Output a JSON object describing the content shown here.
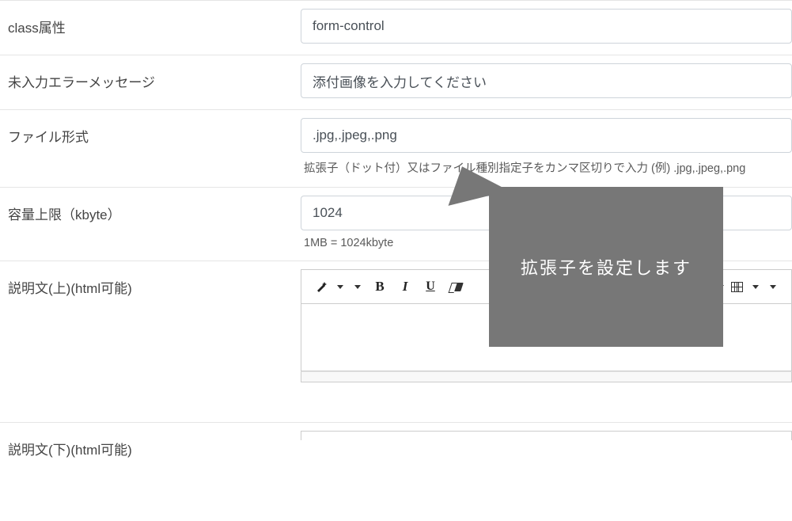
{
  "rows": {
    "class_attr": {
      "label": "class属性",
      "value": "form-control"
    },
    "empty_error": {
      "label": "未入力エラーメッセージ",
      "value": "添付画像を入力してください"
    },
    "file_format": {
      "label": "ファイル形式",
      "value": ".jpg,.jpeg,.png",
      "help": "拡張子（ドット付）又はファイル種別指定子をカンマ区切りで入力 (例) .jpg,.jpeg,.png"
    },
    "size_limit": {
      "label": "容量上限（kbyte）",
      "value": "1024",
      "help": "1MB = 1024kbyte"
    },
    "desc_top": {
      "label": "説明文(上)(html可能)"
    },
    "desc_bottom": {
      "label": "説明文(下)(html可能)"
    }
  },
  "toolbar": {
    "bold": "B",
    "italic": "I",
    "underline": "U"
  },
  "tooltip": {
    "text": "拡張子を設定します"
  }
}
